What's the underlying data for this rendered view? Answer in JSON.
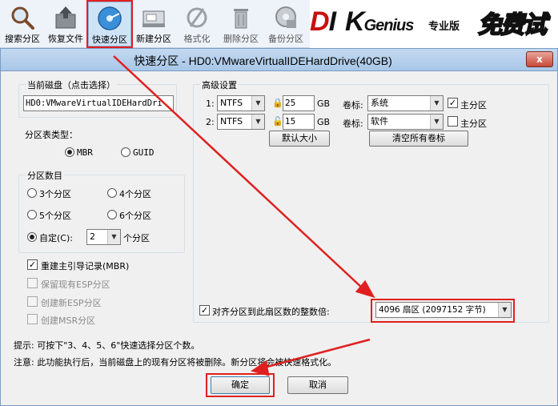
{
  "toolbar": {
    "items": [
      {
        "label": "搜索分区",
        "icon": "magnifier-icon"
      },
      {
        "label": "恢复文件",
        "icon": "restore-file-icon"
      },
      {
        "label": "快速分区",
        "icon": "quick-partition-icon"
      },
      {
        "label": "新建分区",
        "icon": "new-partition-icon"
      },
      {
        "label": "格式化",
        "icon": "format-icon"
      },
      {
        "label": "删除分区",
        "icon": "trash-icon"
      },
      {
        "label": "备份分区",
        "icon": "backup-icon"
      }
    ],
    "banner": {
      "logo_a": "D",
      "logo_b": "I",
      "logo_c": "K",
      "logo_d": "Genius",
      "edition": "专业版",
      "trial": "免费试用"
    }
  },
  "dialog": {
    "title": "快速分区 - HD0:VMwareVirtualIDEHardDrive(40GB)",
    "close": "x",
    "current_disk": {
      "title": "当前磁盘（点击选择）",
      "value": "HD0:VMwareVirtualIDEHardDri"
    },
    "partition_table": {
      "title": "分区表类型：",
      "options": [
        "MBR",
        "GUID"
      ]
    },
    "partition_count": {
      "title": "分区数目",
      "options": [
        "3个分区",
        "4个分区",
        "5个分区",
        "6个分区"
      ],
      "custom_label": "自定(C):",
      "custom_value": "2",
      "custom_suffix": "个分区"
    },
    "checks": {
      "rebuild_mbr": "重建主引导记录(MBR)",
      "keep_esp": "保留现有ESP分区",
      "create_esp": "创建新ESP分区",
      "create_msr": "创建MSR分区"
    },
    "advanced": {
      "title": "高级设置",
      "rows": [
        {
          "index": "1:",
          "fs": "NTFS",
          "size": "25",
          "unit": "GB",
          "vol_label": "卷标:",
          "vol": "系统",
          "primary": "主分区"
        },
        {
          "index": "2:",
          "fs": "NTFS",
          "size": "15",
          "unit": "GB",
          "vol_label": "卷标:",
          "vol": "软件",
          "primary": "主分区"
        }
      ],
      "default_size_btn": "默认大小",
      "clear_labels_btn": "清空所有卷标",
      "align_label": "对齐分区到此扇区数的整数倍:",
      "align_value": "4096 扇区 (2097152 字节)"
    },
    "hint1": "提示: 可按下\"3、4、5、6\"快速选择分区个数。",
    "hint2": "注意: 此功能执行后，当前磁盘上的现有分区将被删除。新分区将会被快速格式化。",
    "ok": "确定",
    "cancel": "取消"
  },
  "colors": {
    "annotation": "#e02020",
    "toolbar_bg": "#eef3fa",
    "dialog_bg": "#f0f0f0"
  }
}
